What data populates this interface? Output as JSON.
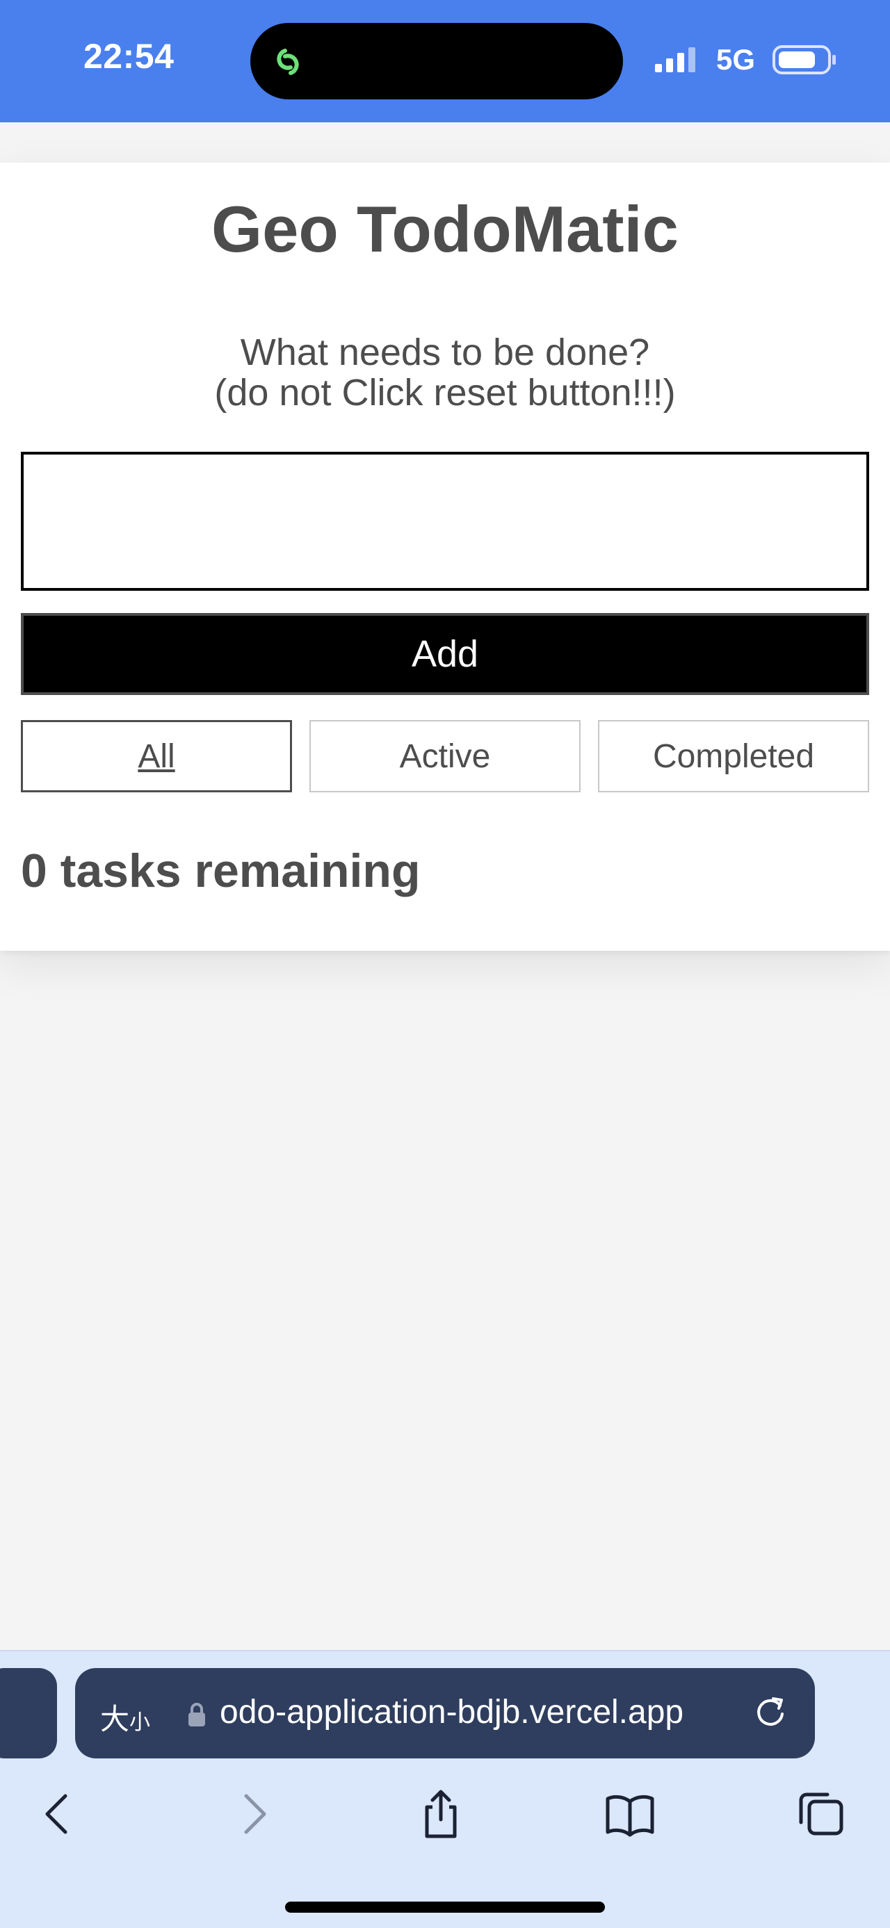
{
  "status_bar": {
    "time": "22:54",
    "network": "5G",
    "island_icon": "link-rings-icon",
    "signal_icon": "signal-bars-icon",
    "battery_icon": "battery-icon"
  },
  "app": {
    "title": "Geo TodoMatic",
    "prompt_line1": "What needs to be done?",
    "prompt_line2": "(do not Click reset button!!!)",
    "input_value": "",
    "add_label": "Add",
    "filters": [
      {
        "label": "All",
        "selected": true
      },
      {
        "label": "Active",
        "selected": false
      },
      {
        "label": "Completed",
        "selected": false
      }
    ],
    "remaining_text": "0 tasks remaining"
  },
  "browser": {
    "text_size_label": "大",
    "text_size_small": "小",
    "url": "odo-application-bdjb.vercel.app",
    "lock_icon": "lock-icon",
    "reload_icon": "reload-icon",
    "toolbar_icons": [
      "back-icon",
      "forward-icon",
      "share-icon",
      "bookmarks-icon",
      "tabs-icon"
    ]
  },
  "colors": {
    "status_bar_bg": "#4a7fee",
    "text_dark": "#4d4d4d",
    "add_button_bg": "#000000",
    "url_bar_bg": "#2f3e5e",
    "browser_bar_bg": "#dbe7fb"
  }
}
